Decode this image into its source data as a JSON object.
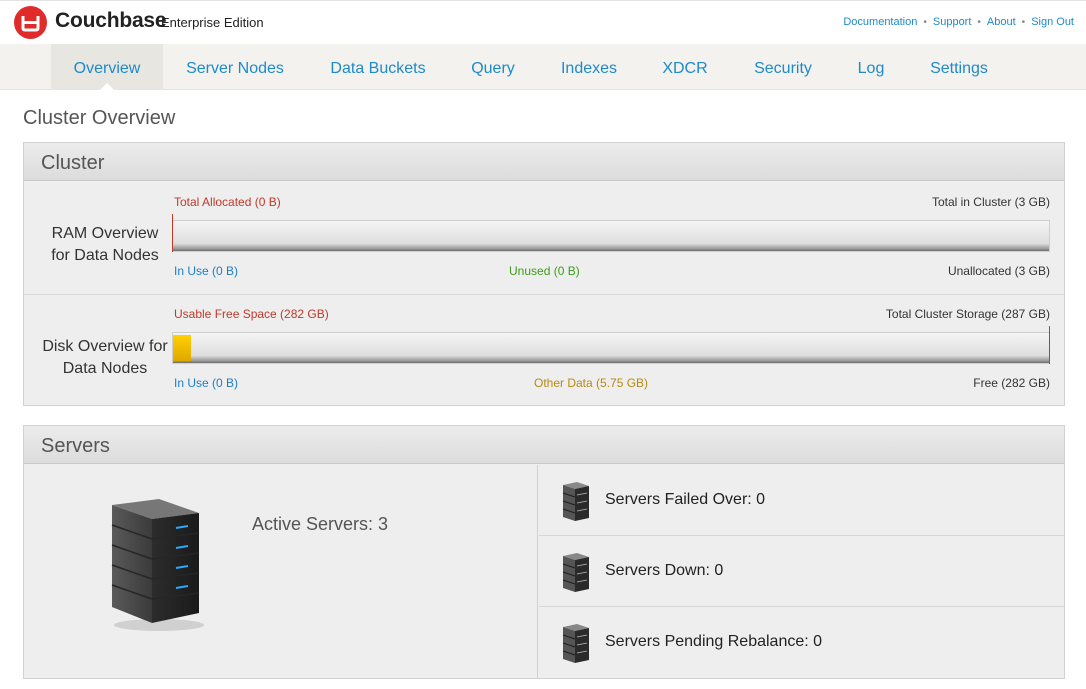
{
  "header": {
    "brand": "Couchbase",
    "edition": "Enterprise Edition",
    "links": [
      "Documentation",
      "Support",
      "About",
      "Sign Out"
    ],
    "accent_color": "#1e8ac8",
    "logo_color": "#e02b2b"
  },
  "nav": {
    "items": [
      "Overview",
      "Server Nodes",
      "Data Buckets",
      "Query",
      "Indexes",
      "XDCR",
      "Security",
      "Log",
      "Settings"
    ],
    "active": "Overview"
  },
  "page_title": "Cluster Overview",
  "cluster": {
    "title": "Cluster",
    "ram": {
      "label_line1": "RAM Overview",
      "label_line2": "for Data Nodes",
      "top_left": "Total Allocated (0 B)",
      "top_right": "Total in Cluster (3 GB)",
      "bottom_left": "In Use (0 B)",
      "bottom_mid": "Unused (0 B)",
      "bottom_right": "Unallocated (3 GB)",
      "fill_fraction": 0
    },
    "disk": {
      "label_line1": "Disk Overview for",
      "label_line2": "Data Nodes",
      "top_left": "Usable Free Space (282 GB)",
      "top_right": "Total Cluster Storage (287 GB)",
      "bottom_left": "In Use (0 B)",
      "bottom_mid": "Other Data (5.75 GB)",
      "bottom_right": "Free (282 GB)",
      "other_fraction": 0.02
    }
  },
  "servers": {
    "title": "Servers",
    "active": "Active Servers: 3",
    "items": [
      "Servers Failed Over: 0",
      "Servers Down: 0",
      "Servers Pending Rebalance: 0"
    ]
  }
}
